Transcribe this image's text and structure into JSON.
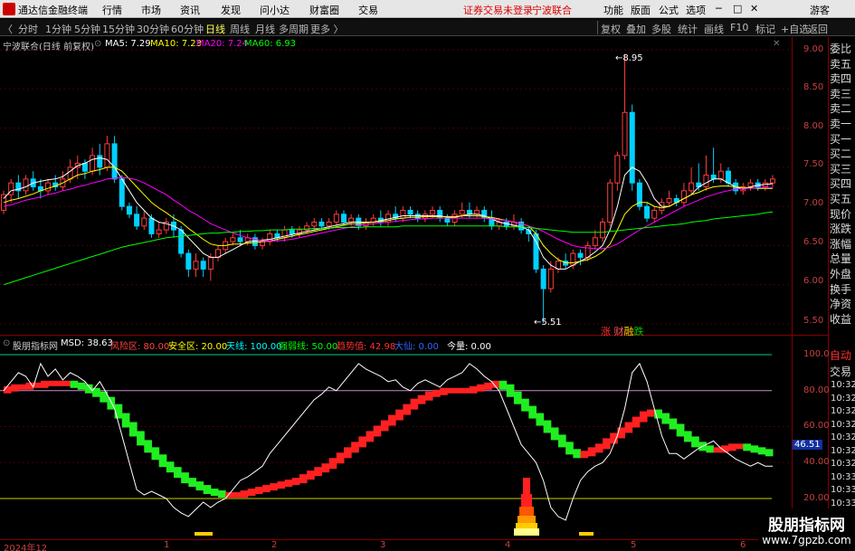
{
  "titlebar": {
    "app_name": "通达信金融终端",
    "menu": [
      "行情",
      "市场",
      "资讯",
      "发现",
      "问小达",
      "财富圈",
      "交易"
    ],
    "notice": "证券交易未登录",
    "stock": "宁波联合",
    "right_menu": [
      "功能",
      "版面",
      "公式",
      "选项"
    ],
    "user": "游客"
  },
  "toolbar": {
    "periods": [
      "分时",
      "1分钟",
      "5分钟",
      "15分钟",
      "30分钟",
      "60分钟",
      "日线",
      "周线",
      "月线",
      "多周期",
      "更多 〉"
    ],
    "active_period": "日线",
    "right_buttons": [
      "复权",
      "叠加",
      "多股",
      "统计",
      "画线",
      "F10",
      "标记",
      "+自选",
      "返回"
    ]
  },
  "price_panel": {
    "title": "宁波联合(日线 前复权)",
    "ma": [
      {
        "label": "MA5: 7.29",
        "color": "#ffffff"
      },
      {
        "label": "MA10: 7.23",
        "color": "#ffff00"
      },
      {
        "label": "MA20: 7.24",
        "color": "#ff00ff"
      },
      {
        "label": "MA60: 6.93",
        "color": "#00ff00"
      }
    ],
    "y_ticks": [
      "9.00",
      "8.50",
      "8.00",
      "7.50",
      "7.00",
      "6.50",
      "6.00",
      "5.50"
    ],
    "high_label": "8.95",
    "low_label": "5.51",
    "event_labels": [
      "涨",
      "财",
      "融",
      "跌"
    ],
    "event_colors": [
      "#ff3030",
      "#ff5555",
      "#ffcc00",
      "#00cc00"
    ]
  },
  "indicator_panel": {
    "name": "股朋指标网",
    "params": [
      {
        "label": "MSD: 38.63",
        "color": "#ffffff"
      },
      {
        "label": "风险区: 80.00",
        "color": "#ff4444"
      },
      {
        "label": "安全区: 20.00",
        "color": "#ffff00"
      },
      {
        "label": "天线: 100.00",
        "color": "#00ffff"
      },
      {
        "label": "强弱线: 50.00",
        "color": "#00ff00"
      },
      {
        "label": "趋势值: 42.98",
        "color": "#ff3030"
      },
      {
        "label": "大仙: 0.00",
        "color": "#3366ff"
      },
      {
        "label": "今量: 0.00",
        "color": "#ffffff"
      }
    ],
    "y_ticks": [
      "100.0",
      "80.00",
      "60.00",
      "40.00",
      "20.00"
    ],
    "current_value": "46.51"
  },
  "x_axis": {
    "labels": [
      "2024年12",
      "1",
      "2",
      "3",
      "4",
      "5",
      "6"
    ]
  },
  "side_quotes": [
    "委比",
    "卖五",
    "卖四",
    "卖三",
    "卖二",
    "卖一",
    "买一",
    "买二",
    "买三",
    "买四",
    "买五",
    "现价",
    "涨跌",
    "涨幅",
    "总量",
    "外盘",
    "换手",
    "净资",
    "收益"
  ],
  "side_trades": {
    "header": [
      "自动",
      "交易"
    ],
    "times": [
      "10:32",
      "10:32",
      "10:32",
      "10:32",
      "10:32",
      "10:32",
      "10:32",
      "10:33",
      "10:33",
      "10:33",
      "10:33",
      "10:33",
      "10:33"
    ]
  },
  "watermark": {
    "text": "股朋指标网",
    "url": "www.7gpzb.com"
  },
  "chart_data": {
    "type": "candlestick",
    "ylim": [
      5.4,
      9.1
    ],
    "candles": [
      [
        6.95,
        7.15,
        6.9,
        7.2
      ],
      [
        7.15,
        7.3,
        7.05,
        7.35
      ],
      [
        7.3,
        7.2,
        7.1,
        7.4
      ],
      [
        7.2,
        7.35,
        7.15,
        7.4
      ],
      [
        7.35,
        7.25,
        7.2,
        7.45
      ],
      [
        7.25,
        7.2,
        7.1,
        7.35
      ],
      [
        7.2,
        7.3,
        7.15,
        7.35
      ],
      [
        7.3,
        7.25,
        7.2,
        7.4
      ],
      [
        7.25,
        7.35,
        7.2,
        7.45
      ],
      [
        7.35,
        7.5,
        7.3,
        7.6
      ],
      [
        7.5,
        7.55,
        7.35,
        7.65
      ],
      [
        7.55,
        7.45,
        7.35,
        7.6
      ],
      [
        7.45,
        7.65,
        7.4,
        7.75
      ],
      [
        7.65,
        7.5,
        7.4,
        7.8
      ],
      [
        7.5,
        7.8,
        7.45,
        7.9
      ],
      [
        7.8,
        7.35,
        7.3,
        7.9
      ],
      [
        7.35,
        7.0,
        6.95,
        7.4
      ],
      [
        7.0,
        6.9,
        6.85,
        7.05
      ],
      [
        6.9,
        6.75,
        6.7,
        7.0
      ],
      [
        6.75,
        6.85,
        6.7,
        6.95
      ],
      [
        6.85,
        6.65,
        6.6,
        6.9
      ],
      [
        6.65,
        6.7,
        6.6,
        6.8
      ],
      [
        6.7,
        6.8,
        6.65,
        6.85
      ],
      [
        6.8,
        6.7,
        6.6,
        6.9
      ],
      [
        6.7,
        6.4,
        6.35,
        6.75
      ],
      [
        6.4,
        6.2,
        6.1,
        6.45
      ],
      [
        6.2,
        6.3,
        6.1,
        6.4
      ],
      [
        6.3,
        6.2,
        6.1,
        6.35
      ],
      [
        6.2,
        6.35,
        6.05,
        6.4
      ],
      [
        6.35,
        6.45,
        6.3,
        6.5
      ],
      [
        6.45,
        6.55,
        6.4,
        6.6
      ],
      [
        6.55,
        6.6,
        6.5,
        6.65
      ],
      [
        6.6,
        6.55,
        6.5,
        6.7
      ],
      [
        6.55,
        6.6,
        6.5,
        6.65
      ],
      [
        6.6,
        6.5,
        6.45,
        6.65
      ],
      [
        6.5,
        6.55,
        6.45,
        6.6
      ],
      [
        6.55,
        6.65,
        6.5,
        6.7
      ],
      [
        6.65,
        6.6,
        6.55,
        6.7
      ],
      [
        6.6,
        6.7,
        6.55,
        6.75
      ],
      [
        6.7,
        6.65,
        6.6,
        6.75
      ],
      [
        6.65,
        6.7,
        6.6,
        6.75
      ],
      [
        6.7,
        6.75,
        6.65,
        6.8
      ],
      [
        6.75,
        6.8,
        6.7,
        6.85
      ],
      [
        6.8,
        6.75,
        6.7,
        6.85
      ],
      [
        6.75,
        6.8,
        6.7,
        6.85
      ],
      [
        6.8,
        6.9,
        6.75,
        6.95
      ],
      [
        6.9,
        6.8,
        6.75,
        6.95
      ],
      [
        6.8,
        6.85,
        6.75,
        6.9
      ],
      [
        6.85,
        6.75,
        6.7,
        6.9
      ],
      [
        6.75,
        6.8,
        6.7,
        6.85
      ],
      [
        6.8,
        6.85,
        6.75,
        6.9
      ],
      [
        6.85,
        6.8,
        6.75,
        6.95
      ],
      [
        6.8,
        6.9,
        6.75,
        6.95
      ],
      [
        6.9,
        6.85,
        6.8,
        7.0
      ],
      [
        6.85,
        6.95,
        6.8,
        7.0
      ],
      [
        6.95,
        6.9,
        6.85,
        7.0
      ],
      [
        6.9,
        6.85,
        6.8,
        6.95
      ],
      [
        6.85,
        6.9,
        6.8,
        6.95
      ],
      [
        6.9,
        6.95,
        6.85,
        7.0
      ],
      [
        6.95,
        6.85,
        6.8,
        7.0
      ],
      [
        6.85,
        6.8,
        6.75,
        6.9
      ],
      [
        6.8,
        6.9,
        6.75,
        6.95
      ],
      [
        6.9,
        6.95,
        6.85,
        7.05
      ],
      [
        6.95,
        6.9,
        6.85,
        7.05
      ],
      [
        6.9,
        6.95,
        6.85,
        7.0
      ],
      [
        6.95,
        6.85,
        6.8,
        7.0
      ],
      [
        6.85,
        6.75,
        6.7,
        6.95
      ],
      [
        6.75,
        6.8,
        6.7,
        6.85
      ],
      [
        6.8,
        6.75,
        6.7,
        6.85
      ],
      [
        6.75,
        6.8,
        6.7,
        6.9
      ],
      [
        6.8,
        6.7,
        6.65,
        6.85
      ],
      [
        6.7,
        6.65,
        6.55,
        6.75
      ],
      [
        6.65,
        6.2,
        6.15,
        6.7
      ],
      [
        6.2,
        5.95,
        5.51,
        6.25
      ],
      [
        5.95,
        6.2,
        5.9,
        6.3
      ],
      [
        6.2,
        6.3,
        6.15,
        6.35
      ],
      [
        6.3,
        6.25,
        6.2,
        6.4
      ],
      [
        6.25,
        6.4,
        6.2,
        6.45
      ],
      [
        6.4,
        6.35,
        6.25,
        6.45
      ],
      [
        6.35,
        6.5,
        6.3,
        6.55
      ],
      [
        6.5,
        6.6,
        6.45,
        6.7
      ],
      [
        6.6,
        6.8,
        6.55,
        6.85
      ],
      [
        6.8,
        7.3,
        6.75,
        7.35
      ],
      [
        7.3,
        7.65,
        7.2,
        7.7
      ],
      [
        7.65,
        8.2,
        7.6,
        8.95
      ],
      [
        8.2,
        7.3,
        7.2,
        8.3
      ],
      [
        7.3,
        7.0,
        6.95,
        7.35
      ],
      [
        7.0,
        6.85,
        6.8,
        7.05
      ],
      [
        6.85,
        6.95,
        6.8,
        7.0
      ],
      [
        6.95,
        7.05,
        6.9,
        7.1
      ],
      [
        7.05,
        7.1,
        7.0,
        7.2
      ],
      [
        7.1,
        7.05,
        7.0,
        7.15
      ],
      [
        7.05,
        7.2,
        7.0,
        7.3
      ],
      [
        7.2,
        7.3,
        7.15,
        7.5
      ],
      [
        7.3,
        7.25,
        7.2,
        7.55
      ],
      [
        7.25,
        7.4,
        7.2,
        7.65
      ],
      [
        7.4,
        7.35,
        7.3,
        7.75
      ],
      [
        7.35,
        7.45,
        7.3,
        7.55
      ],
      [
        7.45,
        7.3,
        7.25,
        7.5
      ],
      [
        7.3,
        7.2,
        7.15,
        7.35
      ],
      [
        7.2,
        7.25,
        7.15,
        7.3
      ],
      [
        7.25,
        7.3,
        7.2,
        7.35
      ],
      [
        7.3,
        7.25,
        7.2,
        7.35
      ],
      [
        7.25,
        7.3,
        7.2,
        7.35
      ],
      [
        7.3,
        7.35,
        7.25,
        7.4
      ]
    ],
    "ma5": [
      7.1,
      7.2,
      7.22,
      7.25,
      7.3,
      7.32,
      7.34,
      7.35,
      7.38,
      7.45,
      7.52,
      7.55,
      7.6,
      7.62,
      7.6,
      7.5,
      7.35,
      7.2,
      7.05,
      6.95,
      6.85,
      6.8,
      6.78,
      6.75,
      6.7,
      6.6,
      6.5,
      6.4,
      6.35,
      6.35,
      6.4,
      6.45,
      6.5,
      6.55,
      6.56,
      6.57,
      6.58,
      6.6,
      6.62,
      6.64,
      6.66,
      6.68,
      6.7,
      6.72,
      6.74,
      6.76,
      6.78,
      6.8,
      6.8,
      6.8,
      6.8,
      6.82,
      6.84,
      6.86,
      6.88,
      6.88,
      6.88,
      6.88,
      6.88,
      6.88,
      6.86,
      6.86,
      6.88,
      6.9,
      6.9,
      6.88,
      6.84,
      6.8,
      6.78,
      6.76,
      6.74,
      6.7,
      6.55,
      6.35,
      6.25,
      6.2,
      6.2,
      6.25,
      6.3,
      6.35,
      6.42,
      6.5,
      6.7,
      7.0,
      7.4,
      7.5,
      7.45,
      7.3,
      7.1,
      7.0,
      7.0,
      7.05,
      7.1,
      7.15,
      7.25,
      7.3,
      7.35,
      7.35,
      7.3,
      7.25,
      7.22,
      7.25,
      7.27,
      7.28,
      7.29
    ],
    "ma10": [
      7.05,
      7.08,
      7.1,
      7.13,
      7.16,
      7.2,
      7.23,
      7.26,
      7.3,
      7.35,
      7.4,
      7.42,
      7.45,
      7.47,
      7.5,
      7.5,
      7.45,
      7.35,
      7.25,
      7.15,
      7.05,
      6.98,
      6.92,
      6.85,
      6.8,
      6.72,
      6.65,
      6.58,
      6.52,
      6.5,
      6.5,
      6.52,
      6.52,
      6.53,
      6.54,
      6.55,
      6.56,
      6.58,
      6.6,
      6.62,
      6.64,
      6.66,
      6.68,
      6.7,
      6.72,
      6.74,
      6.76,
      6.78,
      6.78,
      6.79,
      6.8,
      6.81,
      6.82,
      6.84,
      6.85,
      6.86,
      6.86,
      6.87,
      6.87,
      6.87,
      6.87,
      6.87,
      6.88,
      6.88,
      6.88,
      6.87,
      6.86,
      6.84,
      6.82,
      6.8,
      6.78,
      6.75,
      6.65,
      6.5,
      6.4,
      6.32,
      6.28,
      6.28,
      6.3,
      6.32,
      6.36,
      6.42,
      6.52,
      6.7,
      6.9,
      7.0,
      7.05,
      7.05,
      7.0,
      6.98,
      7.0,
      7.05,
      7.1,
      7.15,
      7.18,
      7.22,
      7.25,
      7.26,
      7.26,
      7.25,
      7.24,
      7.24,
      7.23,
      7.23,
      7.23
    ],
    "ma20": [
      7.0,
      7.02,
      7.05,
      7.08,
      7.1,
      7.12,
      7.15,
      7.17,
      7.2,
      7.22,
      7.25,
      7.27,
      7.3,
      7.32,
      7.35,
      7.36,
      7.37,
      7.36,
      7.34,
      7.3,
      7.25,
      7.2,
      7.15,
      7.08,
      7.02,
      6.95,
      6.9,
      6.84,
      6.78,
      6.74,
      6.7,
      6.66,
      6.63,
      6.6,
      6.58,
      6.56,
      6.56,
      6.56,
      6.57,
      6.58,
      6.6,
      6.62,
      6.64,
      6.66,
      6.68,
      6.7,
      6.72,
      6.74,
      6.76,
      6.77,
      6.78,
      6.79,
      6.8,
      6.81,
      6.82,
      6.83,
      6.84,
      6.84,
      6.85,
      6.85,
      6.85,
      6.85,
      6.85,
      6.85,
      6.85,
      6.85,
      6.84,
      6.83,
      6.82,
      6.8,
      6.78,
      6.75,
      6.72,
      6.68,
      6.63,
      6.58,
      6.54,
      6.5,
      6.48,
      6.47,
      6.46,
      6.46,
      6.48,
      6.52,
      6.58,
      6.64,
      6.7,
      6.75,
      6.8,
      6.85,
      6.9,
      6.95,
      7.0,
      7.04,
      7.08,
      7.12,
      7.15,
      7.18,
      7.2,
      7.22,
      7.23,
      7.23,
      7.24,
      7.24,
      7.24
    ],
    "ma60": [
      6.0,
      6.03,
      6.06,
      6.09,
      6.12,
      6.15,
      6.18,
      6.21,
      6.24,
      6.27,
      6.3,
      6.33,
      6.36,
      6.39,
      6.42,
      6.45,
      6.48,
      6.5,
      6.52,
      6.54,
      6.56,
      6.58,
      6.6,
      6.61,
      6.62,
      6.63,
      6.64,
      6.65,
      6.66,
      6.66,
      6.67,
      6.67,
      6.68,
      6.68,
      6.69,
      6.69,
      6.7,
      6.7,
      6.7,
      6.71,
      6.71,
      6.71,
      6.72,
      6.72,
      6.72,
      6.73,
      6.73,
      6.73,
      6.73,
      6.74,
      6.74,
      6.74,
      6.74,
      6.74,
      6.75,
      6.75,
      6.75,
      6.75,
      6.75,
      6.75,
      6.75,
      6.75,
      6.75,
      6.75,
      6.75,
      6.75,
      6.75,
      6.75,
      6.74,
      6.74,
      6.74,
      6.73,
      6.72,
      6.71,
      6.7,
      6.69,
      6.68,
      6.67,
      6.67,
      6.67,
      6.67,
      6.67,
      6.68,
      6.69,
      6.7,
      6.71,
      6.72,
      6.73,
      6.74,
      6.75,
      6.76,
      6.77,
      6.78,
      6.8,
      6.81,
      6.82,
      6.84,
      6.85,
      6.86,
      6.87,
      6.88,
      6.89,
      6.9,
      6.92,
      6.93
    ],
    "msd": [
      80,
      85,
      90,
      88,
      82,
      95,
      88,
      92,
      86,
      90,
      88,
      85,
      80,
      85,
      78,
      70,
      55,
      40,
      25,
      22,
      24,
      22,
      20,
      15,
      12,
      10,
      14,
      18,
      15,
      18,
      20,
      25,
      30,
      32,
      35,
      38,
      45,
      50,
      55,
      60,
      65,
      70,
      75,
      78,
      82,
      80,
      85,
      90,
      95,
      92,
      90,
      88,
      85,
      86,
      82,
      80,
      84,
      86,
      84,
      82,
      86,
      88,
      90,
      95,
      92,
      88,
      85,
      80,
      70,
      60,
      50,
      45,
      40,
      30,
      15,
      10,
      8,
      20,
      30,
      35,
      38,
      40,
      45,
      55,
      70,
      90,
      95,
      85,
      70,
      55,
      45,
      45,
      42,
      45,
      48,
      50,
      52,
      48,
      45,
      42,
      40,
      38,
      40,
      38,
      38
    ],
    "trend": [
      80,
      81,
      82,
      82,
      83,
      83,
      84,
      84,
      84,
      84,
      83,
      82,
      80,
      78,
      75,
      71,
      66,
      61,
      56,
      51,
      47,
      43,
      39,
      36,
      33,
      30,
      28,
      26,
      24,
      23,
      22,
      22,
      22,
      23,
      24,
      25,
      26,
      27,
      28,
      29,
      30,
      32,
      34,
      36,
      38,
      41,
      44,
      47,
      50,
      53,
      56,
      59,
      62,
      65,
      68,
      71,
      74,
      76,
      78,
      79,
      80,
      80,
      80,
      80,
      81,
      82,
      83,
      84,
      82,
      78,
      74,
      70,
      66,
      62,
      58,
      54,
      50,
      46,
      44,
      45,
      47,
      49,
      52,
      55,
      58,
      61,
      64,
      67,
      68,
      66,
      63,
      60,
      56,
      53,
      50,
      48,
      47,
      47,
      48,
      49,
      49,
      48,
      47,
      46,
      45
    ]
  }
}
